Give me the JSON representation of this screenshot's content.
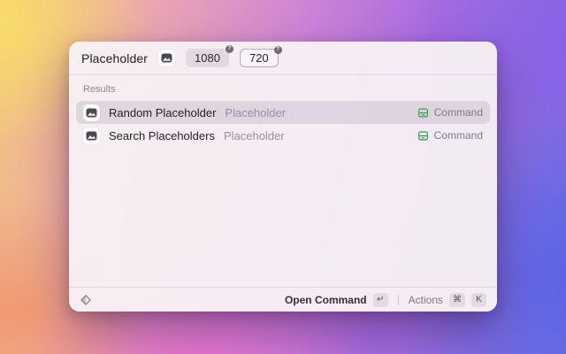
{
  "window": {
    "search": {
      "value": "Placeholder",
      "app_icon": "placeholder-image-icon"
    },
    "arguments": [
      {
        "value": "1080",
        "badge": "?"
      },
      {
        "value": "720",
        "badge": "?"
      }
    ],
    "results": {
      "header": "Results",
      "items": [
        {
          "title": "Random Placeholder",
          "subtitle": "Placeholder",
          "accessory": "Command",
          "icon": "placeholder-image-icon",
          "accessory_icon": "command-drawer-icon",
          "selected": true
        },
        {
          "title": "Search Placeholders",
          "subtitle": "Placeholder",
          "accessory": "Command",
          "icon": "placeholder-image-icon",
          "accessory_icon": "command-drawer-icon",
          "selected": false
        }
      ]
    },
    "footer": {
      "extension_icon": "diamond-icon",
      "primary_action": "Open Command",
      "primary_key": "↵",
      "actions_label": "Actions",
      "actions_keys": [
        "⌘",
        "K"
      ]
    }
  },
  "colors": {
    "accent_green": "#3da35a",
    "window_background": "#f7f0f5",
    "selection_highlight": "#e4dbe2",
    "primary_text": "#211d27",
    "secondary_text": "#8d8794"
  }
}
